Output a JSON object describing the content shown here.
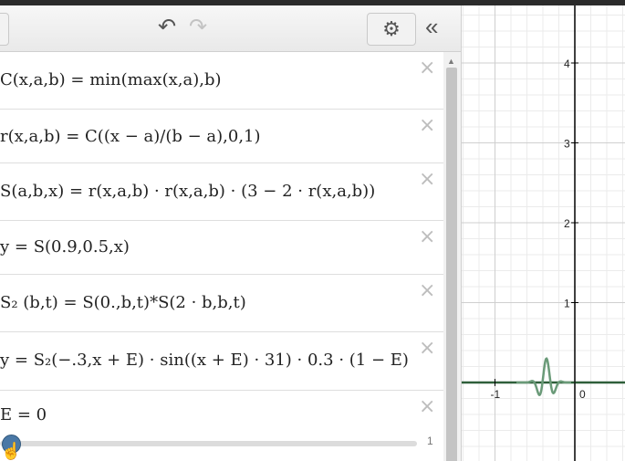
{
  "toolbar": {
    "undo_icon": "↶",
    "redo_icon": "↷",
    "settings_icon": "⚙",
    "collapse_icon": "«"
  },
  "expressions": [
    {
      "text": "C(x,a,b) = min(max(x,a),b)"
    },
    {
      "text": "r(x,a,b) = C((x − a)/(b − a),0,1)"
    },
    {
      "text": "S(a,b,x) = r(x,a,b) · r(x,a,b) · (3 − 2 · r(x,a,b))"
    },
    {
      "text": "y = S(0.9,0.5,x)"
    },
    {
      "text": "S₂ (b,t) = S(0.,b,t)*S(2 · b,b,t)"
    },
    {
      "text": "y = S₂(−.3,x + E) · sin((x + E) · 31) · 0.3 · (1 − E)"
    },
    {
      "text": "E = 0"
    }
  ],
  "slider": {
    "variable": "E",
    "value": 0,
    "min": 0,
    "max": "1"
  },
  "close_icon": "×",
  "graph": {
    "x_tick_labels": [
      "-1",
      "0"
    ],
    "y_tick_labels": [
      "4",
      "3",
      "2",
      "1"
    ],
    "curve_color": "#6a9a78",
    "axis_color": "#000000",
    "horizontal_line_color": "#2f5f3a",
    "wave": {
      "amplitude": 0.3,
      "frequency": 31,
      "center": 0
    }
  }
}
